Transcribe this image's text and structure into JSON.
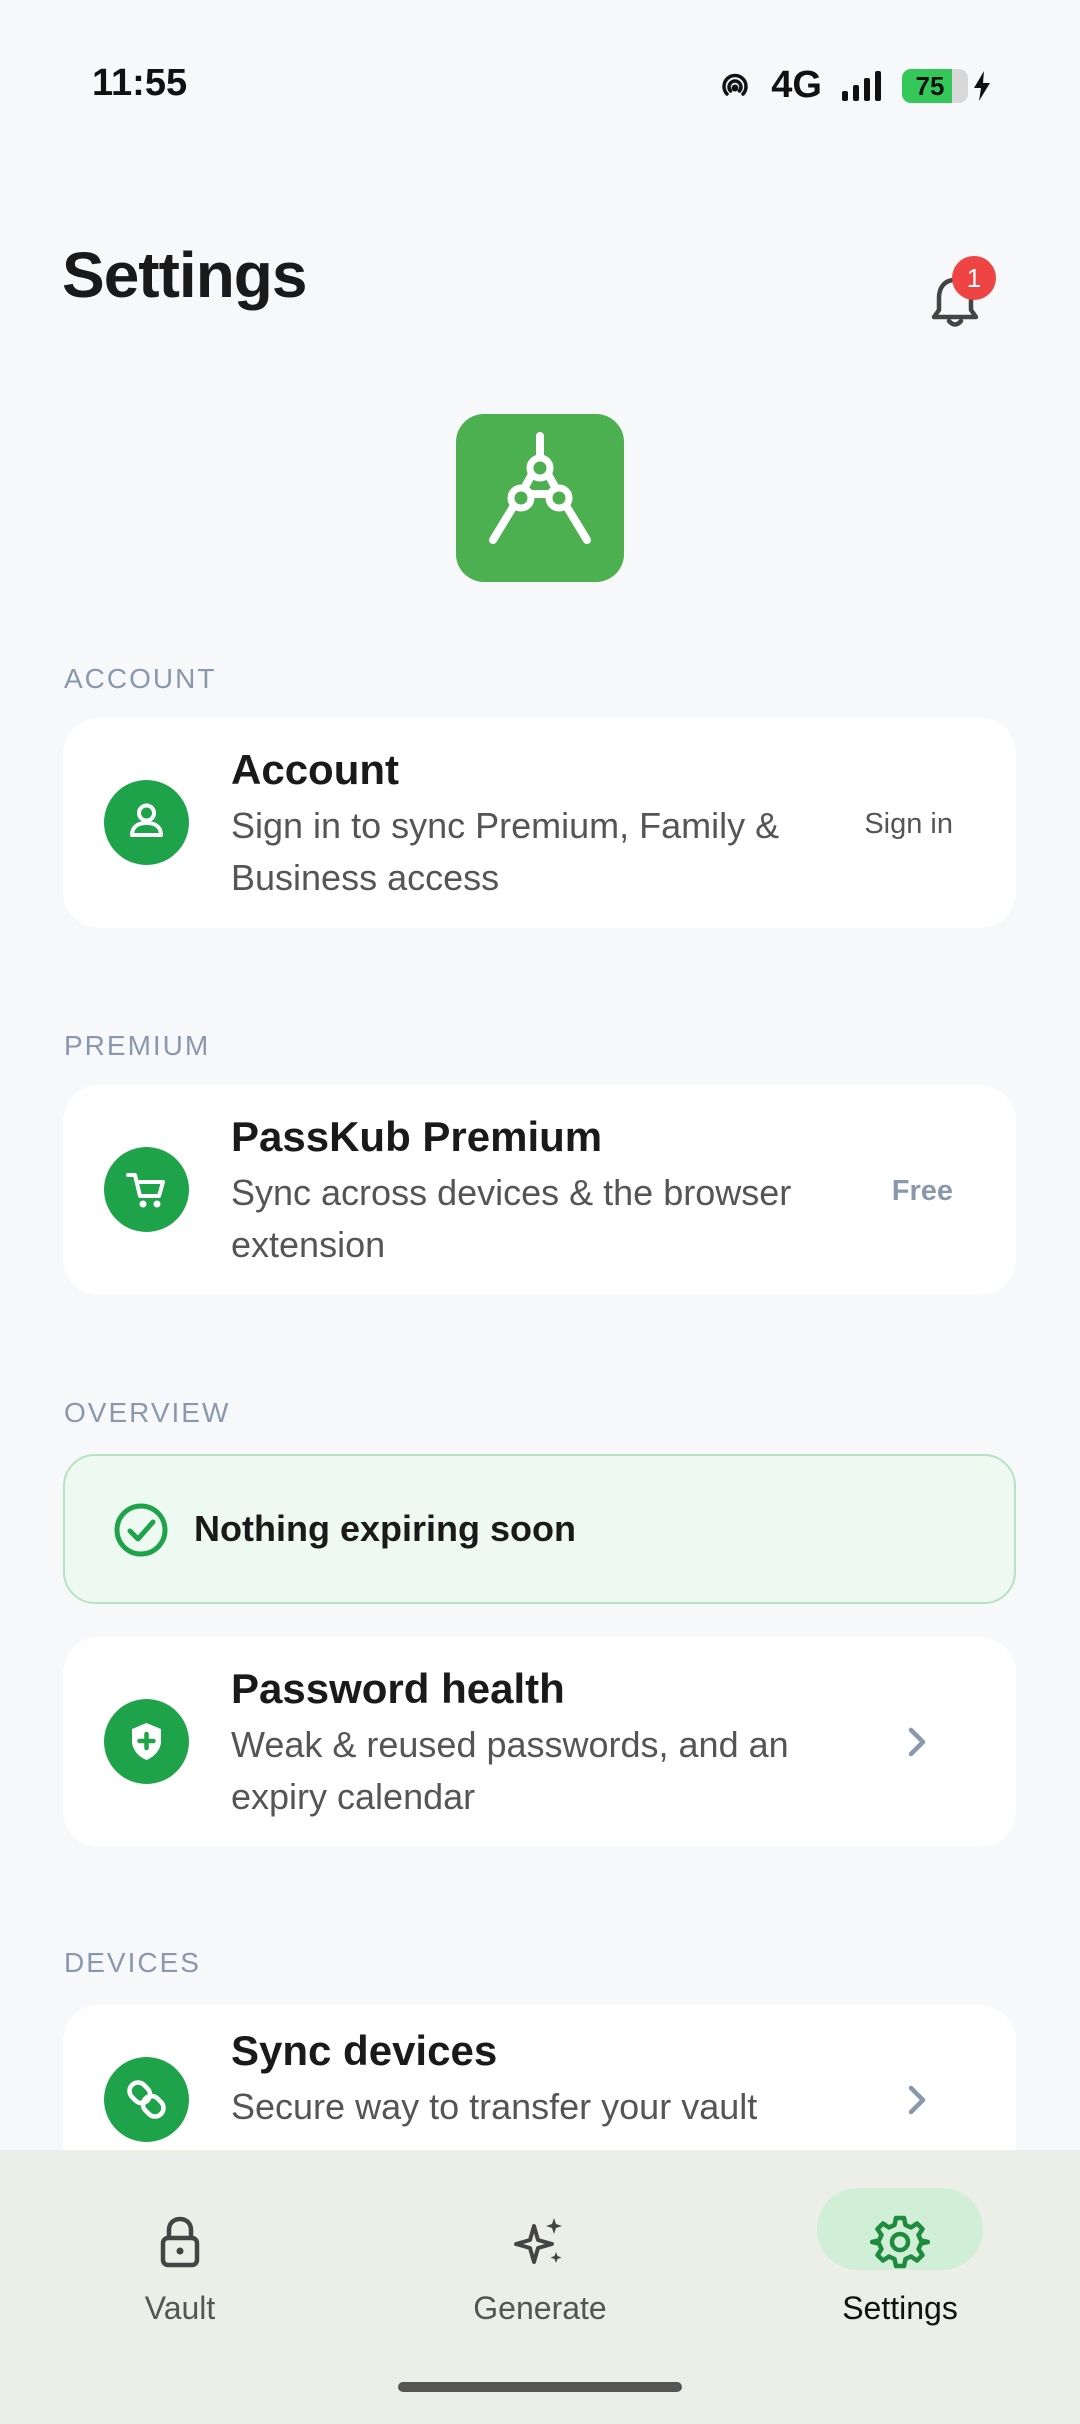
{
  "status": {
    "time": "11:55",
    "network": "4G",
    "battery": "75",
    "battery_level": 0.75
  },
  "header": {
    "title": "Settings",
    "notification_count": "1"
  },
  "sections": {
    "account": {
      "label": "ACCOUNT",
      "title": "Account",
      "subtitle": "Sign in to sync Premium, Family & Business access",
      "trailing": "Sign in",
      "icon": "person-icon"
    },
    "premium": {
      "label": "PREMIUM",
      "title": "PassKub Premium",
      "subtitle": "Sync across devices & the browser extension",
      "trailing": "Free",
      "icon": "cart-icon"
    },
    "overview": {
      "label": "OVERVIEW",
      "notice": "Nothing expiring soon",
      "health_title": "Password health",
      "health_subtitle": "Weak & reused passwords, and an expiry calendar",
      "icon": "shield-plus-icon"
    },
    "devices": {
      "label": "DEVICES",
      "title": "Sync devices",
      "subtitle": "Secure way to transfer your vault",
      "icon": "link-icon"
    }
  },
  "nav": {
    "items": [
      {
        "label": "Vault",
        "icon": "lock-icon"
      },
      {
        "label": "Generate",
        "icon": "sparkle-icon"
      },
      {
        "label": "Settings",
        "icon": "gear-icon",
        "active": true
      }
    ]
  },
  "colors": {
    "accent": "#1fa34a",
    "logo": "#4caf50",
    "badge": "#ef4444",
    "active_pill": "#d1eed6"
  }
}
